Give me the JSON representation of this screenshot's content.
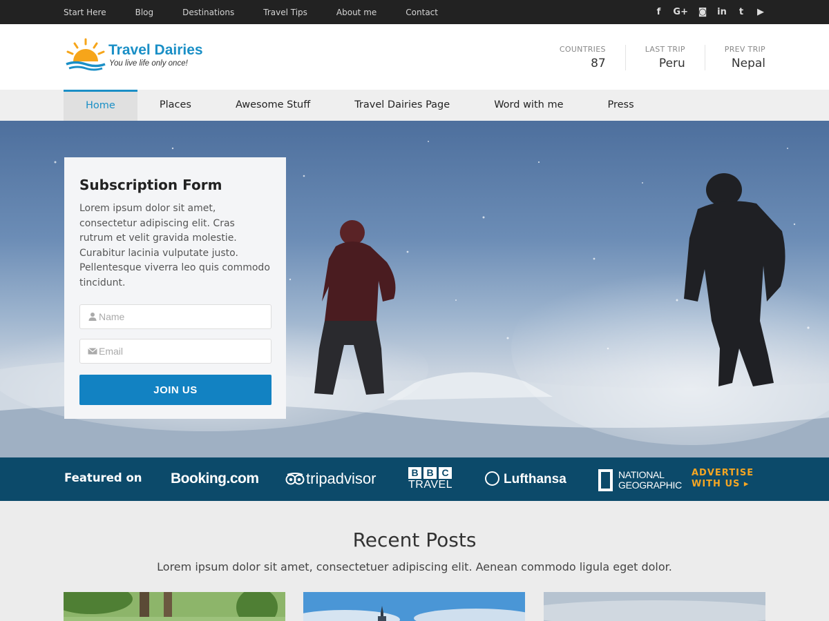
{
  "topbar": {
    "links": [
      "Start Here",
      "Blog",
      "Destinations",
      "Travel Tips",
      "About me",
      "Contact"
    ],
    "social_icons": [
      "facebook-icon",
      "google-plus-icon",
      "instagram-icon",
      "linkedin-icon",
      "twitter-icon",
      "youtube-icon"
    ],
    "social_glyphs": [
      "f",
      "G+",
      "◙",
      "in",
      "t",
      "▶"
    ]
  },
  "header": {
    "logo_title": "Travel Dairies",
    "logo_tagline": "You live life only once!",
    "stats": [
      {
        "label": "COUNTRIES",
        "value": "87"
      },
      {
        "label": "LAST TRIP",
        "value": "Peru"
      },
      {
        "label": "PREV TRIP",
        "value": "Nepal"
      }
    ]
  },
  "nav": {
    "items": [
      "Home",
      "Places",
      "Awesome Stuff",
      "Travel Dairies Page",
      "Word with me",
      "Press"
    ],
    "active": "Home"
  },
  "subscription": {
    "title": "Subscription Form",
    "text": "Lorem ipsum dolor sit amet, consectetur adipiscing elit. Cras rutrum et velit gravida molestie. Curabitur lacinia vulputate justo. Pellentesque viverra leo quis commodo tincidunt.",
    "name_placeholder": "Name",
    "email_placeholder": "Email",
    "button_label": "JOIN US"
  },
  "featured": {
    "label": "Featured on",
    "brands": {
      "booking": "Booking.com",
      "tripadvisor": "tripadvisor",
      "bbc_letters": [
        "B",
        "B",
        "C"
      ],
      "bbc_sub": "TRAVEL",
      "lufthansa": "Lufthansa",
      "natgeo_line1": "NATIONAL",
      "natgeo_line2": "GEOGRAPHIC"
    },
    "advertise_line1": "ADVERTISE",
    "advertise_line2": "WITH US ▸"
  },
  "recent_posts": {
    "title": "Recent Posts",
    "subtitle": "Lorem ipsum dolor sit amet, consectetuer adipiscing elit. Aenean commodo ligula eget dolor."
  },
  "colors": {
    "accent": "#1a8fc6",
    "button": "#1282c2",
    "featured_bg": "#0c4a6a",
    "advertise": "#f5a623",
    "topbar_bg": "#222222"
  }
}
